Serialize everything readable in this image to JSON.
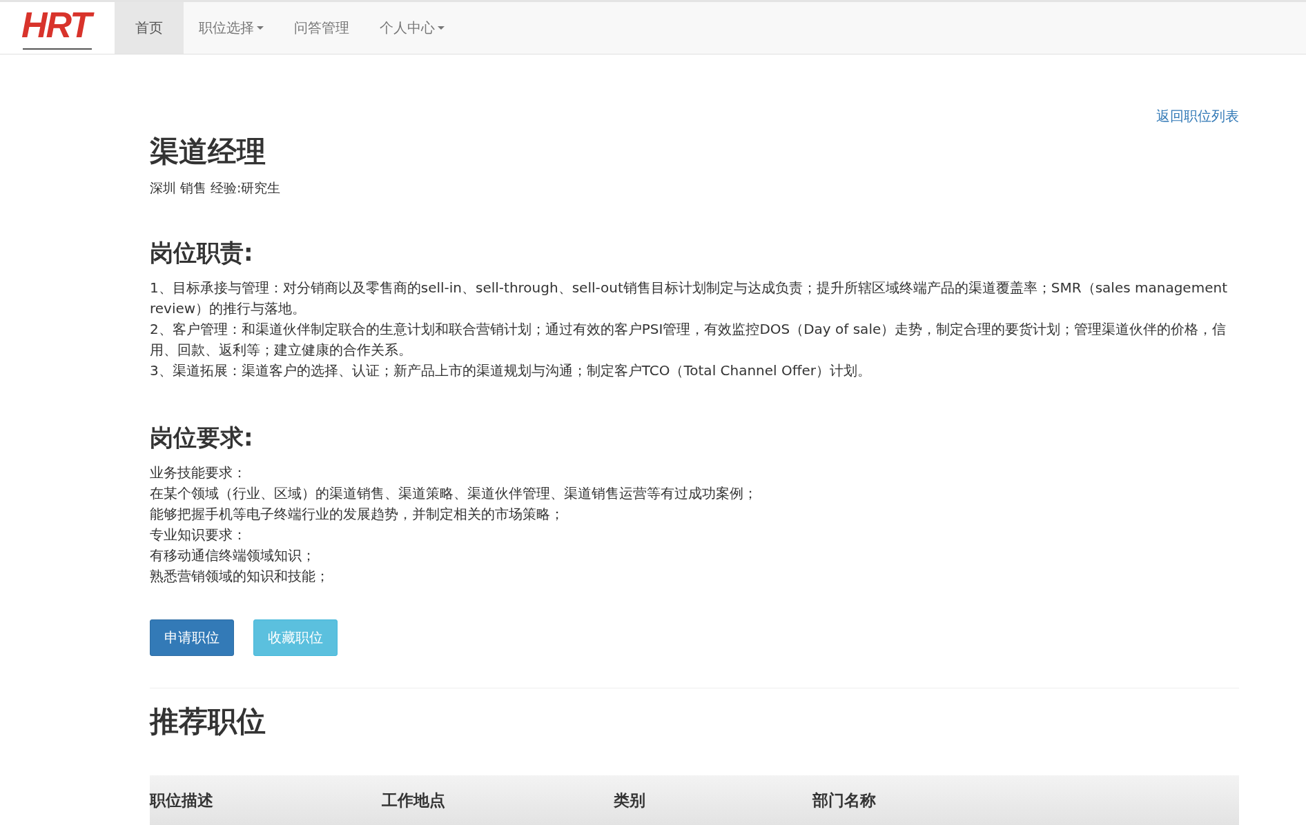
{
  "logo": {
    "text": "HRT"
  },
  "nav": [
    {
      "label": "首页",
      "selected": true,
      "dropdown": false
    },
    {
      "label": "职位选择",
      "selected": false,
      "dropdown": true
    },
    {
      "label": "问答管理",
      "selected": false,
      "dropdown": false
    },
    {
      "label": "个人中心",
      "selected": false,
      "dropdown": true
    }
  ],
  "back_link": "返回职位列表",
  "job": {
    "title": "渠道经理",
    "meta": "深圳 销售 经验:研究生"
  },
  "sections": [
    {
      "heading": "岗位职责:",
      "lines": [
        "1、目标承接与管理：对分销商以及零售商的sell-in、sell-through、sell-out销售目标计划制定与达成负责；提升所辖区域终端产品的渠道覆盖率；SMR（sales management review）的推行与落地。",
        "2、客户管理：和渠道伙伴制定联合的生意计划和联合营销计划；通过有效的客户PSI管理，有效监控DOS（Day of sale）走势，制定合理的要货计划；管理渠道伙伴的价格，信用、回款、返利等；建立健康的合作关系。",
        "3、渠道拓展：渠道客户的选择、认证；新产品上市的渠道规划与沟通；制定客户TCO（Total Channel Offer）计划。"
      ]
    },
    {
      "heading": "岗位要求:",
      "lines": [
        "业务技能要求：",
        "在某个领域（行业、区域）的渠道销售、渠道策略、渠道伙伴管理、渠道销售运营等有过成功案例；",
        "能够把握手机等电子终端行业的发展趋势，并制定相关的市场策略；",
        "专业知识要求：",
        "有移动通信终端领域知识；",
        "熟悉营销领域的知识和技能；"
      ]
    }
  ],
  "buttons": [
    {
      "label": "申请职位",
      "kind": "primary"
    },
    {
      "label": "收藏职位",
      "kind": "info"
    }
  ],
  "recommended": {
    "heading": "推荐职位",
    "columns": [
      "职位描述",
      "工作地点",
      "类别",
      "部门名称"
    ]
  }
}
